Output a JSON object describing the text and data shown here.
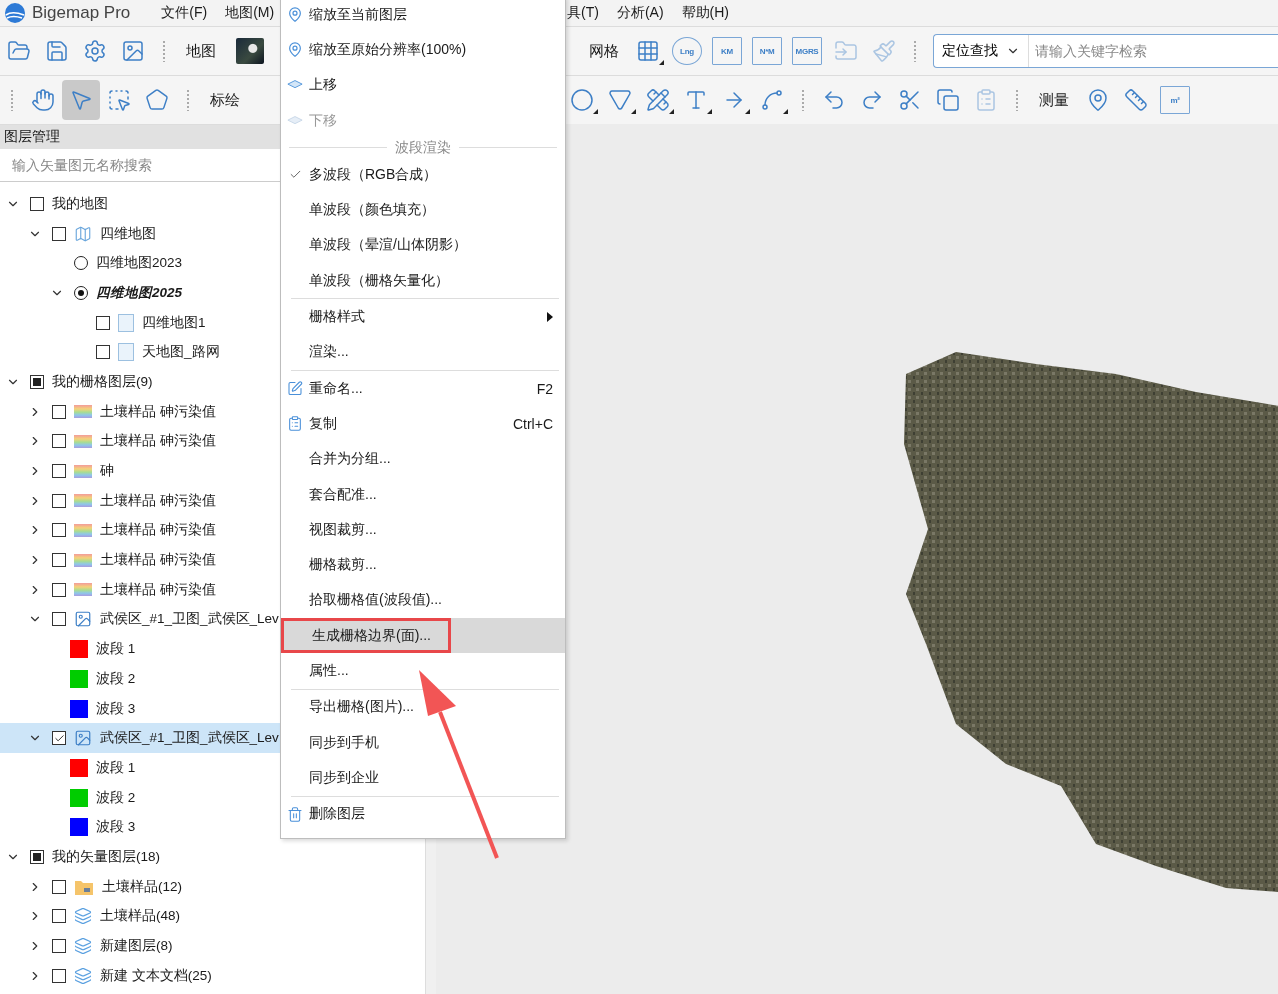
{
  "app": {
    "title": "Bigemap Pro"
  },
  "menubar": {
    "left": [
      "文件(F)",
      "地图(M)"
    ],
    "right": [
      "具(T)",
      "分析(A)",
      "帮助(H)"
    ]
  },
  "toolbar_top": {
    "left": [
      {
        "kind": "open",
        "disabled": false
      },
      {
        "kind": "save",
        "disabled": false
      },
      {
        "kind": "settings",
        "disabled": false
      },
      {
        "kind": "picture",
        "disabled": false
      },
      {
        "kind": "grip"
      },
      {
        "kind": "label",
        "label": "地图"
      },
      {
        "kind": "thumbnail"
      }
    ],
    "right": [
      {
        "kind": "label",
        "label": "网格"
      },
      {
        "kind": "grid",
        "dropdown": true,
        "disabled": false
      },
      {
        "kind": "globetag",
        "text": "Lng"
      },
      {
        "kind": "gridtag",
        "text": "KM"
      },
      {
        "kind": "gridtag",
        "text": "N*M"
      },
      {
        "kind": "gridtag",
        "text": "MGRS"
      },
      {
        "kind": "import",
        "disabled": true
      },
      {
        "kind": "brush",
        "disabled": true
      },
      {
        "kind": "grip"
      }
    ],
    "locator": {
      "mode": "定位查找",
      "placeholder": "请输入关键字检索"
    }
  },
  "toolbar_bottom": {
    "left": [
      {
        "kind": "grip"
      },
      {
        "kind": "hand",
        "selected": false
      },
      {
        "kind": "pointer",
        "selected": true
      },
      {
        "kind": "marquee",
        "selected": false
      },
      {
        "kind": "lasso",
        "selected": false
      },
      {
        "kind": "grip"
      },
      {
        "kind": "label",
        "label": "标绘"
      }
    ],
    "right": [
      {
        "kind": "circle",
        "dropdown": true,
        "disabled": false
      },
      {
        "kind": "triangle",
        "dropdown": true,
        "disabled": false
      },
      {
        "kind": "drafting",
        "dropdown": true,
        "disabled": false
      },
      {
        "kind": "text",
        "dropdown": true,
        "disabled": false
      },
      {
        "kind": "arrow",
        "dropdown": true,
        "disabled": false
      },
      {
        "kind": "curve",
        "dropdown": true,
        "disabled": false
      },
      {
        "kind": "grip"
      },
      {
        "kind": "undo",
        "disabled": false
      },
      {
        "kind": "redo",
        "disabled": false
      },
      {
        "kind": "cut",
        "disabled": false
      },
      {
        "kind": "copy",
        "disabled": false
      },
      {
        "kind": "paste",
        "disabled": true
      },
      {
        "kind": "grip"
      },
      {
        "kind": "label",
        "label": "测量"
      },
      {
        "kind": "pin",
        "disabled": false
      },
      {
        "kind": "ruler",
        "disabled": false
      },
      {
        "kind": "areatag",
        "text": "m²"
      }
    ]
  },
  "layer_panel": {
    "title": "图层管理",
    "search": {
      "placeholder": "输入矢量图元名称搜索"
    },
    "tree": [
      {
        "kind": "group",
        "label": "我的地图",
        "expanded": true,
        "checked": false,
        "mixed": false,
        "selected": false,
        "children": [
          {
            "kind": "map",
            "label": "四维地图",
            "expanded": true,
            "checked": false,
            "selected": false,
            "children": [
              {
                "kind": "radio",
                "label": "四维地图2023",
                "checked": false,
                "selected": false
              },
              {
                "kind": "radio",
                "label": "四维地图2025",
                "expanded": true,
                "checked": true,
                "selected": false,
                "children": [
                  {
                    "kind": "sheet",
                    "label": "四维地图1",
                    "checked": false,
                    "selected": false
                  },
                  {
                    "kind": "sheet",
                    "label": "天地图_路网",
                    "checked": false,
                    "selected": false
                  }
                ]
              }
            ]
          }
        ]
      },
      {
        "kind": "group",
        "label": "我的栅格图层(9)",
        "expanded": true,
        "checked": false,
        "mixed": true,
        "selected": false,
        "children": [
          {
            "kind": "raster",
            "label": "土壤样品 砷污染值",
            "expanded": false,
            "checked": false,
            "selected": false
          },
          {
            "kind": "raster",
            "label": "土壤样品 砷污染值",
            "expanded": false,
            "checked": false,
            "selected": false
          },
          {
            "kind": "raster",
            "label": "砷",
            "expanded": false,
            "checked": false,
            "selected": false
          },
          {
            "kind": "raster",
            "label": "土壤样品 砷污染值",
            "expanded": false,
            "checked": false,
            "selected": false
          },
          {
            "kind": "raster",
            "label": "土壤样品 砷污染值",
            "expanded": false,
            "checked": false,
            "selected": false
          },
          {
            "kind": "raster",
            "label": "土壤样品 砷污染值",
            "expanded": false,
            "checked": false,
            "selected": false
          },
          {
            "kind": "raster",
            "label": "土壤样品 砷污染值",
            "expanded": false,
            "checked": false,
            "selected": false
          },
          {
            "kind": "image",
            "label": "武侯区_#1_卫图_武侯区_Lev",
            "expanded": true,
            "checked": false,
            "selected": false,
            "children": [
              {
                "kind": "band",
                "label": "波段 1",
                "color": "#ff0000",
                "selected": false
              },
              {
                "kind": "band",
                "label": "波段 2",
                "color": "#00cc00",
                "selected": false
              },
              {
                "kind": "band",
                "label": "波段 3",
                "color": "#0000ff",
                "selected": false
              }
            ]
          },
          {
            "kind": "image",
            "label": "武侯区_#1_卫图_武侯区_Lev",
            "expanded": true,
            "checked": true,
            "selected": true,
            "children": [
              {
                "kind": "band",
                "label": "波段 1",
                "color": "#ff0000",
                "selected": false
              },
              {
                "kind": "band",
                "label": "波段 2",
                "color": "#00cc00",
                "selected": false
              },
              {
                "kind": "band",
                "label": "波段 3",
                "color": "#0000ff",
                "selected": false
              }
            ]
          }
        ]
      },
      {
        "kind": "group",
        "label": "我的矢量图层(18)",
        "expanded": true,
        "checked": false,
        "mixed": true,
        "selected": false,
        "children": [
          {
            "kind": "folder",
            "label": "土壤样品(12)",
            "expanded": false,
            "checked": false,
            "selected": false
          },
          {
            "kind": "layers",
            "label": "土壤样品(48)",
            "expanded": false,
            "checked": false,
            "selected": false
          },
          {
            "kind": "layers",
            "label": "新建图层(8)",
            "expanded": false,
            "checked": false,
            "selected": false
          },
          {
            "kind": "layers",
            "label": "新建 文本文档(25)",
            "expanded": false,
            "checked": false,
            "selected": false
          }
        ]
      }
    ]
  },
  "context_menu": [
    {
      "kind": "zoom",
      "label": "缩放至当前图层",
      "disabled": false,
      "highlighted": false
    },
    {
      "kind": "zoom",
      "label": "缩放至原始分辨率(100%)",
      "disabled": false,
      "highlighted": false
    },
    {
      "kind": "move",
      "label": "上移",
      "disabled": false,
      "highlighted": false
    },
    {
      "kind": "move",
      "label": "下移",
      "disabled": true,
      "highlighted": false
    },
    {
      "kind": "header",
      "label": "波段渲染"
    },
    {
      "kind": "check",
      "label": "多波段（RGB合成）",
      "checked": true
    },
    {
      "kind": "check",
      "label": "单波段（颜色填充）",
      "checked": false
    },
    {
      "kind": "check",
      "label": "单波段（晕渲/山体阴影）",
      "checked": false
    },
    {
      "kind": "check",
      "label": "单波段（栅格矢量化）",
      "checked": false
    },
    {
      "kind": "separator"
    },
    {
      "kind": "submenu",
      "label": "栅格样式"
    },
    {
      "kind": "action",
      "label": "渲染...",
      "disabled": false,
      "highlighted": false
    },
    {
      "kind": "separator"
    },
    {
      "kind": "rename",
      "label": "重命名...",
      "shortcut": "F2",
      "disabled": false,
      "highlighted": false
    },
    {
      "kind": "copy",
      "label": "复制",
      "shortcut": "Ctrl+C",
      "disabled": false,
      "highlighted": false
    },
    {
      "kind": "action",
      "label": "合并为分组...",
      "disabled": false,
      "highlighted": false
    },
    {
      "kind": "action",
      "label": "套合配准...",
      "disabled": false,
      "highlighted": false
    },
    {
      "kind": "action",
      "label": "视图裁剪...",
      "disabled": false,
      "highlighted": false
    },
    {
      "kind": "action",
      "label": "栅格裁剪...",
      "disabled": false,
      "highlighted": false
    },
    {
      "kind": "action",
      "label": "拾取栅格值(波段值)...",
      "disabled": false,
      "highlighted": false
    },
    {
      "kind": "action",
      "label": "生成栅格边界(面)...",
      "disabled": false,
      "highlighted": true
    },
    {
      "kind": "action",
      "label": "属性...",
      "disabled": false,
      "highlighted": false
    },
    {
      "kind": "separator"
    },
    {
      "kind": "action",
      "label": "导出栅格(图片)...",
      "disabled": false,
      "highlighted": false
    },
    {
      "kind": "action",
      "label": "同步到手机",
      "disabled": false,
      "highlighted": false
    },
    {
      "kind": "action",
      "label": "同步到企业",
      "disabled": false,
      "highlighted": false
    },
    {
      "kind": "separator"
    },
    {
      "kind": "delete",
      "label": "删除图层",
      "disabled": false,
      "highlighted": false
    }
  ]
}
